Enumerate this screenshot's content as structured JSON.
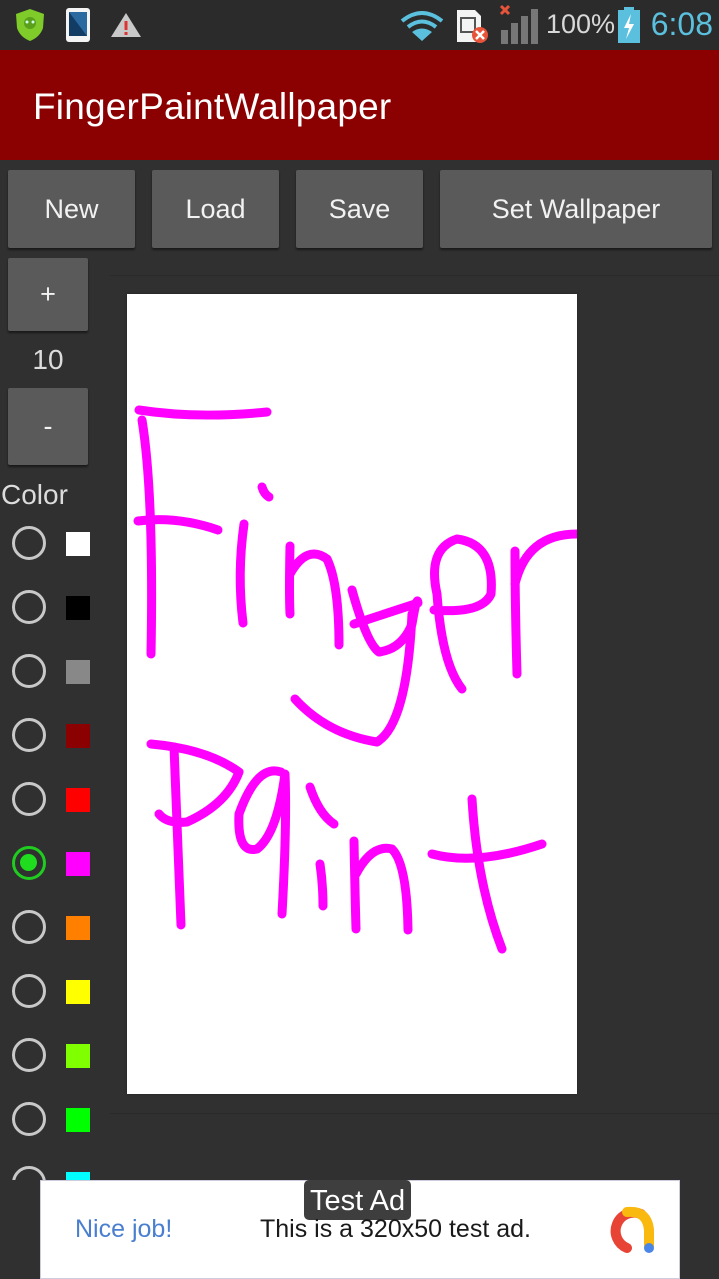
{
  "status_bar": {
    "left_icons": [
      "shield-security-icon",
      "phone-icon",
      "warning-icon"
    ],
    "right_icons": [
      "wifi-icon",
      "sim-error-icon",
      "signal-no-service-icon",
      "battery-charging-icon"
    ],
    "battery": "100%",
    "time": "6:08"
  },
  "app_bar": {
    "title": "FingerPaintWallpaper",
    "color": "#8b0000"
  },
  "toolbar": {
    "new_label": "New",
    "load_label": "Load",
    "save_label": "Save",
    "set_wallpaper_label": "Set Wallpaper"
  },
  "brush": {
    "increase_label": "+",
    "size": "10",
    "decrease_label": "-"
  },
  "palette": {
    "label": "Color",
    "selected": "magenta",
    "colors": [
      {
        "name": "white",
        "hex": "#ffffff",
        "selected": false
      },
      {
        "name": "black",
        "hex": "#000000",
        "selected": false
      },
      {
        "name": "gray",
        "hex": "#888888",
        "selected": false
      },
      {
        "name": "dark-red",
        "hex": "#8b0000",
        "selected": false
      },
      {
        "name": "red",
        "hex": "#ff0000",
        "selected": false
      },
      {
        "name": "magenta",
        "hex": "#ff00ff",
        "selected": true
      },
      {
        "name": "orange",
        "hex": "#ff8000",
        "selected": false
      },
      {
        "name": "yellow",
        "hex": "#ffff00",
        "selected": false
      },
      {
        "name": "lime",
        "hex": "#80ff00",
        "selected": false
      },
      {
        "name": "green",
        "hex": "#00ff00",
        "selected": false
      },
      {
        "name": "cyan",
        "hex": "#00ffff",
        "selected": false
      }
    ]
  },
  "canvas": {
    "drawing_text": "Finger Paint",
    "stroke_color": "#ff00ff",
    "background": "#ffffff"
  },
  "ad": {
    "badge": "Test Ad",
    "headline": "Nice job!",
    "body": "This is a 320x50 test ad.",
    "logo": "ad-network-logo-icon"
  }
}
